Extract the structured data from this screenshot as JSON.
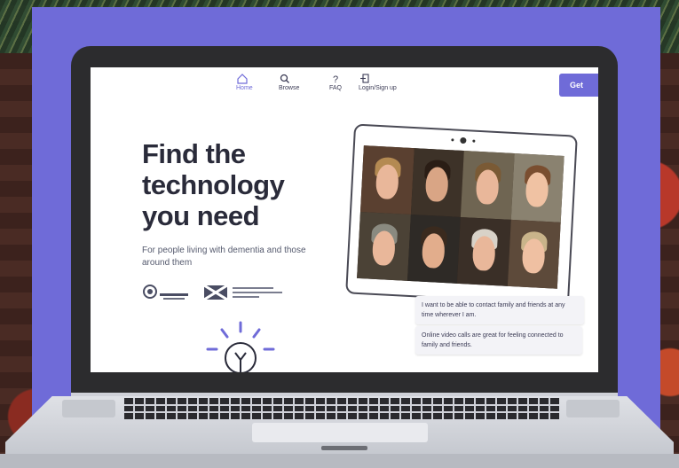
{
  "site": {
    "nav": [
      {
        "label": "Home",
        "icon": "home-icon",
        "active": true
      },
      {
        "label": "Browse",
        "icon": "search-icon",
        "active": false
      },
      {
        "label": "FAQ",
        "icon": "question-icon",
        "active": false
      },
      {
        "label": "Login/Sign up",
        "icon": "login-icon",
        "active": false
      }
    ],
    "cta_label": "Get",
    "hero_title_line1": "Find the",
    "hero_title_line2": "technology",
    "hero_title_line3": "you need",
    "hero_subtitle": "For people living with dementia and those around them",
    "quote_1": "I want to be able to contact family and friends at any time wherever I am.",
    "quote_2": "Online video calls are great for feeling connected to family and friends."
  },
  "colors": {
    "brand": "#6f6bd8",
    "heading": "#2a2b3a",
    "laptop_bezel": "#2c2c2e"
  }
}
